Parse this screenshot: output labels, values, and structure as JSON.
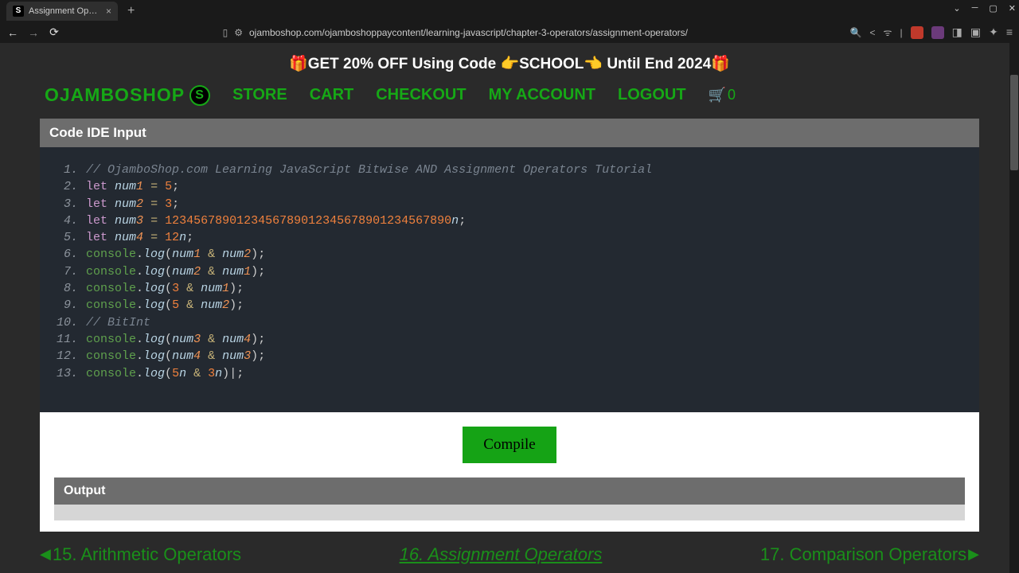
{
  "browser": {
    "tab_title": "Assignment Operators - O",
    "url": "ojamboshop.com/ojamboshoppaycontent/learning-javascript/chapter-3-operators/assignment-operators/"
  },
  "promo": "🎁GET 20% OFF Using Code 👉SCHOOL👈 Until End 2024🎁",
  "nav": {
    "brand": "OJAMBOSHOP",
    "links": [
      "STORE",
      "CART",
      "CHECKOUT",
      "MY ACCOUNT",
      "LOGOUT"
    ],
    "cart_count": "0"
  },
  "ide": {
    "header": "Code IDE Input",
    "compile": "Compile",
    "output_header": "Output"
  },
  "code": [
    {
      "n": "1.",
      "tokens": [
        [
          "comment",
          "// OjamboShop.com Learning JavaScript Bitwise AND Assignment Operators Tutorial"
        ]
      ]
    },
    {
      "n": "2.",
      "tokens": [
        [
          "keyword",
          "let"
        ],
        [
          "sp",
          " "
        ],
        [
          "ident",
          "num"
        ],
        [
          "identn",
          "1"
        ],
        [
          "sp",
          " "
        ],
        [
          "op",
          "="
        ],
        [
          "sp",
          " "
        ],
        [
          "num",
          "5"
        ],
        [
          "punct",
          ";"
        ]
      ]
    },
    {
      "n": "3.",
      "tokens": [
        [
          "keyword",
          "let"
        ],
        [
          "sp",
          " "
        ],
        [
          "ident",
          "num"
        ],
        [
          "identn",
          "2"
        ],
        [
          "sp",
          " "
        ],
        [
          "op",
          "="
        ],
        [
          "sp",
          " "
        ],
        [
          "num",
          "3"
        ],
        [
          "punct",
          ";"
        ]
      ]
    },
    {
      "n": "4.",
      "tokens": [
        [
          "keyword",
          "let"
        ],
        [
          "sp",
          " "
        ],
        [
          "ident",
          "num"
        ],
        [
          "identn",
          "3"
        ],
        [
          "sp",
          " "
        ],
        [
          "op",
          "="
        ],
        [
          "sp",
          " "
        ],
        [
          "num",
          "1234567890123456789012345678901234567890"
        ],
        [
          "ident",
          "n"
        ],
        [
          "punct",
          ";"
        ]
      ]
    },
    {
      "n": "5.",
      "tokens": [
        [
          "keyword",
          "let"
        ],
        [
          "sp",
          " "
        ],
        [
          "ident",
          "num"
        ],
        [
          "identn",
          "4"
        ],
        [
          "sp",
          " "
        ],
        [
          "op",
          "="
        ],
        [
          "sp",
          " "
        ],
        [
          "num",
          "12"
        ],
        [
          "ident",
          "n"
        ],
        [
          "punct",
          ";"
        ]
      ]
    },
    {
      "n": "6.",
      "tokens": [
        [
          "obj",
          "console"
        ],
        [
          "punct",
          "."
        ],
        [
          "method",
          "log"
        ],
        [
          "paren",
          "("
        ],
        [
          "ident",
          "num"
        ],
        [
          "identn",
          "1"
        ],
        [
          "sp",
          " "
        ],
        [
          "op",
          "&"
        ],
        [
          "sp",
          " "
        ],
        [
          "ident",
          "num"
        ],
        [
          "identn",
          "2"
        ],
        [
          "paren",
          ")"
        ],
        [
          "punct",
          ";"
        ]
      ]
    },
    {
      "n": "7.",
      "tokens": [
        [
          "obj",
          "console"
        ],
        [
          "punct",
          "."
        ],
        [
          "method",
          "log"
        ],
        [
          "paren",
          "("
        ],
        [
          "ident",
          "num"
        ],
        [
          "identn",
          "2"
        ],
        [
          "sp",
          " "
        ],
        [
          "op",
          "&"
        ],
        [
          "sp",
          " "
        ],
        [
          "ident",
          "num"
        ],
        [
          "identn",
          "1"
        ],
        [
          "paren",
          ")"
        ],
        [
          "punct",
          ";"
        ]
      ]
    },
    {
      "n": "8.",
      "tokens": [
        [
          "obj",
          "console"
        ],
        [
          "punct",
          "."
        ],
        [
          "method",
          "log"
        ],
        [
          "paren",
          "("
        ],
        [
          "num",
          "3"
        ],
        [
          "sp",
          " "
        ],
        [
          "op",
          "&"
        ],
        [
          "sp",
          " "
        ],
        [
          "ident",
          "num"
        ],
        [
          "identn",
          "1"
        ],
        [
          "paren",
          ")"
        ],
        [
          "punct",
          ";"
        ]
      ]
    },
    {
      "n": "9.",
      "tokens": [
        [
          "obj",
          "console"
        ],
        [
          "punct",
          "."
        ],
        [
          "method",
          "log"
        ],
        [
          "paren",
          "("
        ],
        [
          "num",
          "5"
        ],
        [
          "sp",
          " "
        ],
        [
          "op",
          "&"
        ],
        [
          "sp",
          " "
        ],
        [
          "ident",
          "num"
        ],
        [
          "identn",
          "2"
        ],
        [
          "paren",
          ")"
        ],
        [
          "punct",
          ";"
        ]
      ]
    },
    {
      "n": "10.",
      "tokens": [
        [
          "comment",
          "// BitInt"
        ]
      ]
    },
    {
      "n": "11.",
      "tokens": [
        [
          "obj",
          "console"
        ],
        [
          "punct",
          "."
        ],
        [
          "method",
          "log"
        ],
        [
          "paren",
          "("
        ],
        [
          "ident",
          "num"
        ],
        [
          "identn",
          "3"
        ],
        [
          "sp",
          " "
        ],
        [
          "op",
          "&"
        ],
        [
          "sp",
          " "
        ],
        [
          "ident",
          "num"
        ],
        [
          "identn",
          "4"
        ],
        [
          "paren",
          ")"
        ],
        [
          "punct",
          ";"
        ]
      ]
    },
    {
      "n": "12.",
      "tokens": [
        [
          "obj",
          "console"
        ],
        [
          "punct",
          "."
        ],
        [
          "method",
          "log"
        ],
        [
          "paren",
          "("
        ],
        [
          "ident",
          "num"
        ],
        [
          "identn",
          "4"
        ],
        [
          "sp",
          " "
        ],
        [
          "op",
          "&"
        ],
        [
          "sp",
          " "
        ],
        [
          "ident",
          "num"
        ],
        [
          "identn",
          "3"
        ],
        [
          "paren",
          ")"
        ],
        [
          "punct",
          ";"
        ]
      ]
    },
    {
      "n": "13.",
      "tokens": [
        [
          "obj",
          "console"
        ],
        [
          "punct",
          "."
        ],
        [
          "method",
          "log"
        ],
        [
          "paren",
          "("
        ],
        [
          "num",
          "5"
        ],
        [
          "ident",
          "n"
        ],
        [
          "sp",
          " "
        ],
        [
          "op",
          "&"
        ],
        [
          "sp",
          " "
        ],
        [
          "num",
          "3"
        ],
        [
          "ident",
          "n"
        ],
        [
          "paren",
          ")"
        ],
        [
          "punct",
          "|;"
        ]
      ]
    }
  ],
  "bottom_nav": {
    "prev": "15. Arithmetic Operators",
    "current": "16. Assignment Operators",
    "next": "17. Comparison Operators"
  }
}
